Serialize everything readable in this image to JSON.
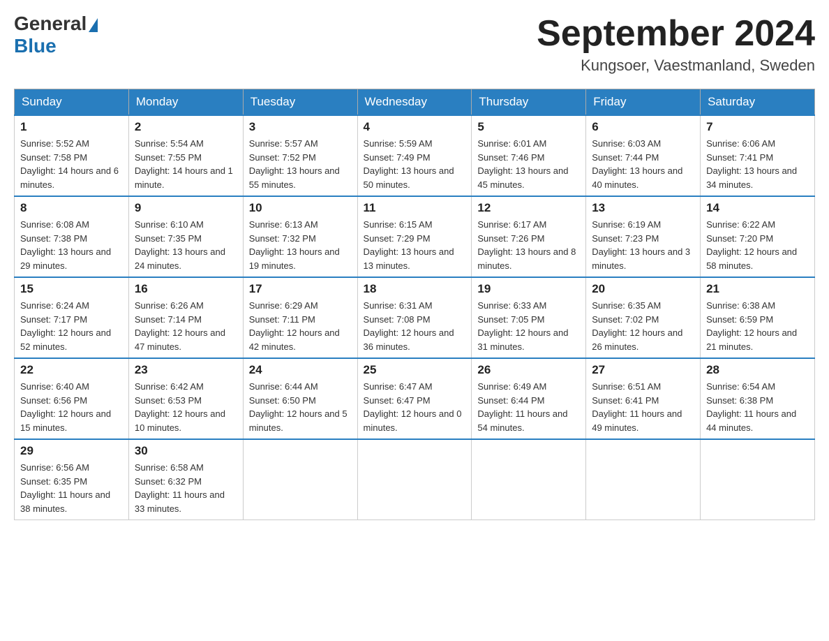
{
  "header": {
    "logo_general": "General",
    "logo_blue": "Blue",
    "month_year": "September 2024",
    "location": "Kungsoer, Vaestmanland, Sweden"
  },
  "days_of_week": [
    "Sunday",
    "Monday",
    "Tuesday",
    "Wednesday",
    "Thursday",
    "Friday",
    "Saturday"
  ],
  "weeks": [
    [
      {
        "day": "1",
        "sunrise": "5:52 AM",
        "sunset": "7:58 PM",
        "daylight": "14 hours and 6 minutes."
      },
      {
        "day": "2",
        "sunrise": "5:54 AM",
        "sunset": "7:55 PM",
        "daylight": "14 hours and 1 minute."
      },
      {
        "day": "3",
        "sunrise": "5:57 AM",
        "sunset": "7:52 PM",
        "daylight": "13 hours and 55 minutes."
      },
      {
        "day": "4",
        "sunrise": "5:59 AM",
        "sunset": "7:49 PM",
        "daylight": "13 hours and 50 minutes."
      },
      {
        "day": "5",
        "sunrise": "6:01 AM",
        "sunset": "7:46 PM",
        "daylight": "13 hours and 45 minutes."
      },
      {
        "day": "6",
        "sunrise": "6:03 AM",
        "sunset": "7:44 PM",
        "daylight": "13 hours and 40 minutes."
      },
      {
        "day": "7",
        "sunrise": "6:06 AM",
        "sunset": "7:41 PM",
        "daylight": "13 hours and 34 minutes."
      }
    ],
    [
      {
        "day": "8",
        "sunrise": "6:08 AM",
        "sunset": "7:38 PM",
        "daylight": "13 hours and 29 minutes."
      },
      {
        "day": "9",
        "sunrise": "6:10 AM",
        "sunset": "7:35 PM",
        "daylight": "13 hours and 24 minutes."
      },
      {
        "day": "10",
        "sunrise": "6:13 AM",
        "sunset": "7:32 PM",
        "daylight": "13 hours and 19 minutes."
      },
      {
        "day": "11",
        "sunrise": "6:15 AM",
        "sunset": "7:29 PM",
        "daylight": "13 hours and 13 minutes."
      },
      {
        "day": "12",
        "sunrise": "6:17 AM",
        "sunset": "7:26 PM",
        "daylight": "13 hours and 8 minutes."
      },
      {
        "day": "13",
        "sunrise": "6:19 AM",
        "sunset": "7:23 PM",
        "daylight": "13 hours and 3 minutes."
      },
      {
        "day": "14",
        "sunrise": "6:22 AM",
        "sunset": "7:20 PM",
        "daylight": "12 hours and 58 minutes."
      }
    ],
    [
      {
        "day": "15",
        "sunrise": "6:24 AM",
        "sunset": "7:17 PM",
        "daylight": "12 hours and 52 minutes."
      },
      {
        "day": "16",
        "sunrise": "6:26 AM",
        "sunset": "7:14 PM",
        "daylight": "12 hours and 47 minutes."
      },
      {
        "day": "17",
        "sunrise": "6:29 AM",
        "sunset": "7:11 PM",
        "daylight": "12 hours and 42 minutes."
      },
      {
        "day": "18",
        "sunrise": "6:31 AM",
        "sunset": "7:08 PM",
        "daylight": "12 hours and 36 minutes."
      },
      {
        "day": "19",
        "sunrise": "6:33 AM",
        "sunset": "7:05 PM",
        "daylight": "12 hours and 31 minutes."
      },
      {
        "day": "20",
        "sunrise": "6:35 AM",
        "sunset": "7:02 PM",
        "daylight": "12 hours and 26 minutes."
      },
      {
        "day": "21",
        "sunrise": "6:38 AM",
        "sunset": "6:59 PM",
        "daylight": "12 hours and 21 minutes."
      }
    ],
    [
      {
        "day": "22",
        "sunrise": "6:40 AM",
        "sunset": "6:56 PM",
        "daylight": "12 hours and 15 minutes."
      },
      {
        "day": "23",
        "sunrise": "6:42 AM",
        "sunset": "6:53 PM",
        "daylight": "12 hours and 10 minutes."
      },
      {
        "day": "24",
        "sunrise": "6:44 AM",
        "sunset": "6:50 PM",
        "daylight": "12 hours and 5 minutes."
      },
      {
        "day": "25",
        "sunrise": "6:47 AM",
        "sunset": "6:47 PM",
        "daylight": "12 hours and 0 minutes."
      },
      {
        "day": "26",
        "sunrise": "6:49 AM",
        "sunset": "6:44 PM",
        "daylight": "11 hours and 54 minutes."
      },
      {
        "day": "27",
        "sunrise": "6:51 AM",
        "sunset": "6:41 PM",
        "daylight": "11 hours and 49 minutes."
      },
      {
        "day": "28",
        "sunrise": "6:54 AM",
        "sunset": "6:38 PM",
        "daylight": "11 hours and 44 minutes."
      }
    ],
    [
      {
        "day": "29",
        "sunrise": "6:56 AM",
        "sunset": "6:35 PM",
        "daylight": "11 hours and 38 minutes."
      },
      {
        "day": "30",
        "sunrise": "6:58 AM",
        "sunset": "6:32 PM",
        "daylight": "11 hours and 33 minutes."
      },
      null,
      null,
      null,
      null,
      null
    ]
  ]
}
